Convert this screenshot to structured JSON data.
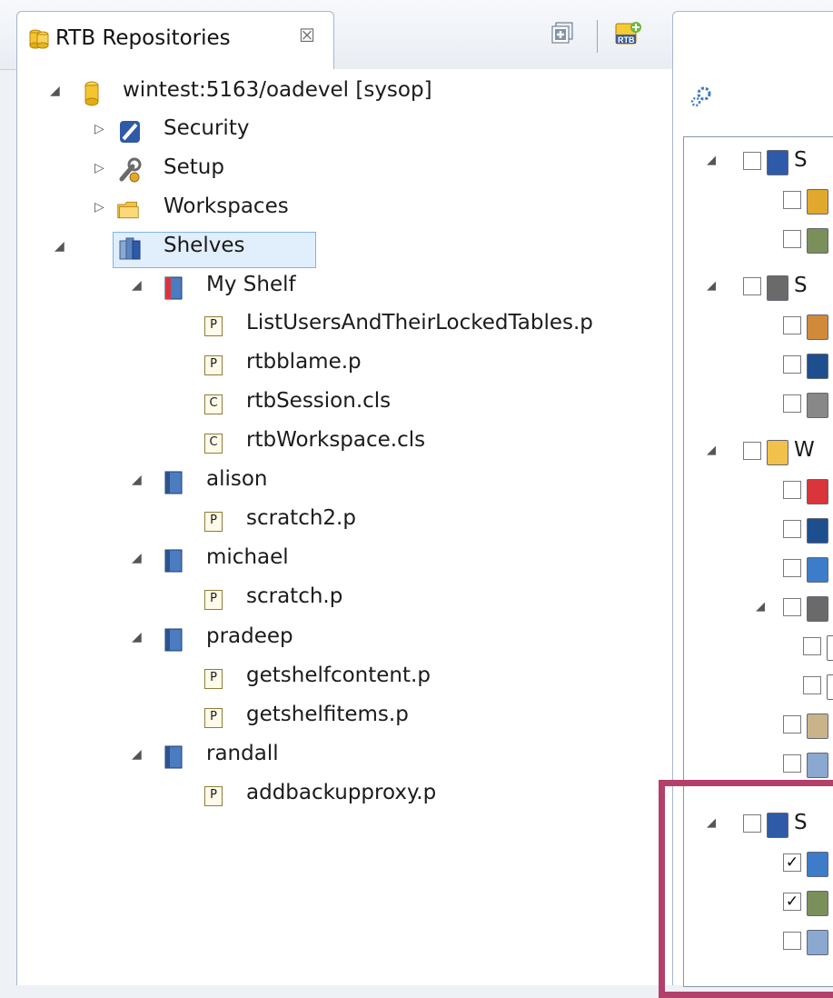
{
  "view_tab": {
    "title": "RTB Repositories",
    "close_glyph": "☒"
  },
  "toolbar": {
    "collapse_icon": "collapse-all-icon",
    "new_repo_icon": "rtb-add-icon",
    "menu_icon": "view-menu-icon",
    "minimize_icon": "minimize-icon",
    "maximize_icon": "maximize-icon",
    "rtb_badge": "RTB"
  },
  "tree": {
    "root": {
      "label": "wintest:5163/oadevel [sysop]",
      "icon": "database-icon"
    },
    "nodes": [
      {
        "label": "Security",
        "icon": "shield-icon",
        "expanded": false
      },
      {
        "label": "Setup",
        "icon": "wrench-gear-icon",
        "expanded": false
      },
      {
        "label": "Workspaces",
        "icon": "folder-icon",
        "expanded": false
      },
      {
        "label": "Shelves",
        "icon": "shelves-icon",
        "expanded": true,
        "selected": true
      }
    ],
    "shelves": [
      {
        "label": "My Shelf",
        "icon": "my-shelf-icon",
        "files": [
          {
            "label": "ListUsersAndTheirLockedTables.p",
            "type": "P"
          },
          {
            "label": "rtbblame.p",
            "type": "P"
          },
          {
            "label": "rtbSession.cls",
            "type": "C"
          },
          {
            "label": "rtbWorkspace.cls",
            "type": "C"
          }
        ]
      },
      {
        "label": "alison",
        "icon": "shelf-icon",
        "files": [
          {
            "label": "scratch2.p",
            "type": "P"
          }
        ]
      },
      {
        "label": "michael",
        "icon": "shelf-icon",
        "files": [
          {
            "label": "scratch.p",
            "type": "P"
          }
        ]
      },
      {
        "label": "pradeep",
        "icon": "shelf-icon",
        "files": [
          {
            "label": "getshelfcontent.p",
            "type": "P"
          },
          {
            "label": "getshelfitems.p",
            "type": "P"
          }
        ]
      },
      {
        "label": "randall",
        "icon": "shelf-icon",
        "files": [
          {
            "label": "addbackupproxy.p",
            "type": "P"
          }
        ]
      }
    ]
  },
  "right_panel": {
    "header_icon": "settings-gears-icon",
    "partial_letters": [
      "S",
      "S",
      "W",
      "S"
    ],
    "checked_rows": [
      17,
      18,
      21
    ]
  },
  "colors": {
    "highlight": "#b2406a",
    "selection": "#e1eefc",
    "accent": "#3d7cc9"
  }
}
